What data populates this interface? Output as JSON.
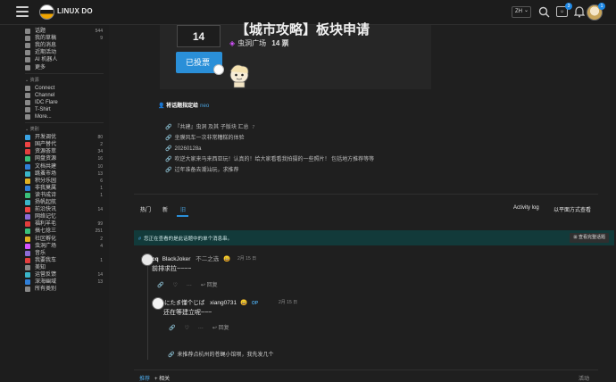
{
  "header": {
    "site_name": "LINUX DO",
    "lang": "ZH",
    "chat_label": "☺",
    "notif_count_a": "3",
    "notif_count_b": "1"
  },
  "sidebar": {
    "items_top": [
      {
        "label": "话题",
        "count": "544",
        "icon_color": "#888888"
      },
      {
        "label": "我的草稿",
        "count": "9",
        "icon_color": "#888888"
      },
      {
        "label": "我的消息",
        "count": "",
        "icon_color": "#888888"
      },
      {
        "label": "近期活动",
        "count": "",
        "icon_color": "#888888"
      },
      {
        "label": "AI 机器人",
        "count": "",
        "icon_color": "#888888"
      },
      {
        "label": "更多",
        "count": "",
        "icon_color": "#888888"
      }
    ],
    "resources_head": "资源",
    "resources": [
      {
        "label": "Connect",
        "icon_color": "#888888"
      },
      {
        "label": "Channel",
        "icon_color": "#888888"
      },
      {
        "label": "IDC Flare",
        "icon_color": "#888888"
      },
      {
        "label": "T-Shirt",
        "icon_color": "#888888"
      },
      {
        "label": "More...",
        "icon_color": "#888888"
      }
    ],
    "categories_head": "类别",
    "categories": [
      {
        "label": "开发调优",
        "count": "80",
        "icon_color": "#3aa3e3"
      },
      {
        "label": "国产替代",
        "count": "2",
        "icon_color": "#e44"
      },
      {
        "label": "资源荟萃",
        "count": "34",
        "icon_color": "#e23d3d"
      },
      {
        "label": "网盘资源",
        "count": "16",
        "icon_color": "#3ac07a"
      },
      {
        "label": "文档共建",
        "count": "10",
        "icon_color": "#2f7fd8"
      },
      {
        "label": "跳蚤市场",
        "count": "13",
        "icon_color": "#3ab5c9"
      },
      {
        "label": "积分乐园",
        "count": "6",
        "icon_color": "#e0b020"
      },
      {
        "label": "非我莫属",
        "count": "1",
        "icon_color": "#2f7fd8"
      },
      {
        "label": "读书成诗",
        "count": "1",
        "icon_color": "#3ac07a"
      },
      {
        "label": "扬帆起航",
        "count": "",
        "icon_color": "#3ab5c9"
      },
      {
        "label": "前沿快讯",
        "count": "14",
        "icon_color": "#e44"
      },
      {
        "label": "网络记忆",
        "count": "",
        "icon_color": "#8c6bd6"
      },
      {
        "label": "福利羊毛",
        "count": "99",
        "icon_color": "#e23d3d"
      },
      {
        "label": "搞七捻三",
        "count": "251",
        "icon_color": "#3ac07a"
      },
      {
        "label": "社区孵化",
        "count": "2",
        "icon_color": "#e0b020"
      },
      {
        "label": "虫洞广场",
        "count": "4",
        "icon_color": "#d552ff"
      },
      {
        "label": "音乐",
        "count": "",
        "icon_color": "#8c6bd6"
      },
      {
        "label": "我要我车",
        "count": "1",
        "icon_color": "#e23d3d"
      },
      {
        "label": "美知",
        "count": "",
        "icon_color": "#888888"
      },
      {
        "label": "运营反馈",
        "count": "14",
        "icon_color": "#3ab5c9"
      },
      {
        "label": "深海幽域",
        "count": "13",
        "icon_color": "#2f7fd8"
      },
      {
        "label": "所有类别",
        "count": "",
        "icon_color": "#888888"
      }
    ]
  },
  "poll": {
    "votes": "14",
    "voted_label": "已投票",
    "title": "【城市攻略】板块申请",
    "category": "虫洞广场",
    "vote_summary": "14 票"
  },
  "assign": {
    "text": "将话题指定给",
    "assignee": "neo"
  },
  "related_links": [
    {
      "text": "『共建』虫洞 及其 子版块 汇总",
      "count": "7"
    },
    {
      "text": "坐膜风车一次非常糟糕的体验",
      "count": ""
    },
    {
      "text": "20260128a",
      "count": ""
    },
    {
      "text": "吹逆大家来马来西亚玩！认真的！给大家看看我拍摄的一些照片！ 包括地方推荐等等",
      "count": ""
    },
    {
      "text": "过年准备去潮汕玩，求推荐",
      "count": ""
    }
  ],
  "tabs": {
    "items": [
      "热门",
      "新",
      "旧"
    ],
    "active_index": 2,
    "activity_log": "Activity log",
    "flat_view": "以平面方式查看"
  },
  "notice": {
    "text": "您正在查看的是此话题中的单个消息串。",
    "button": "查看完整话题"
  },
  "posts": [
    {
      "username": "cq",
      "display_name": "BlackJoker",
      "extra": "不二之选",
      "emoji": "😄",
      "date": "2月 15 日",
      "text": "前排求拉~~~~",
      "reply_label": "回复"
    },
    {
      "username": "にたま懂个じば",
      "display_name": "xiang0731",
      "emoji": "😄",
      "op": "OP",
      "date": "2月 15 日",
      "text": "还在等建立呢~~~",
      "reply_label": "回复"
    }
  ],
  "next_post_preview": "来推荐点杭州的苍蝇小馆呗，我先发几个",
  "bottom": {
    "left_a": "推荐",
    "left_b": "+ 相关",
    "right": "活动"
  }
}
